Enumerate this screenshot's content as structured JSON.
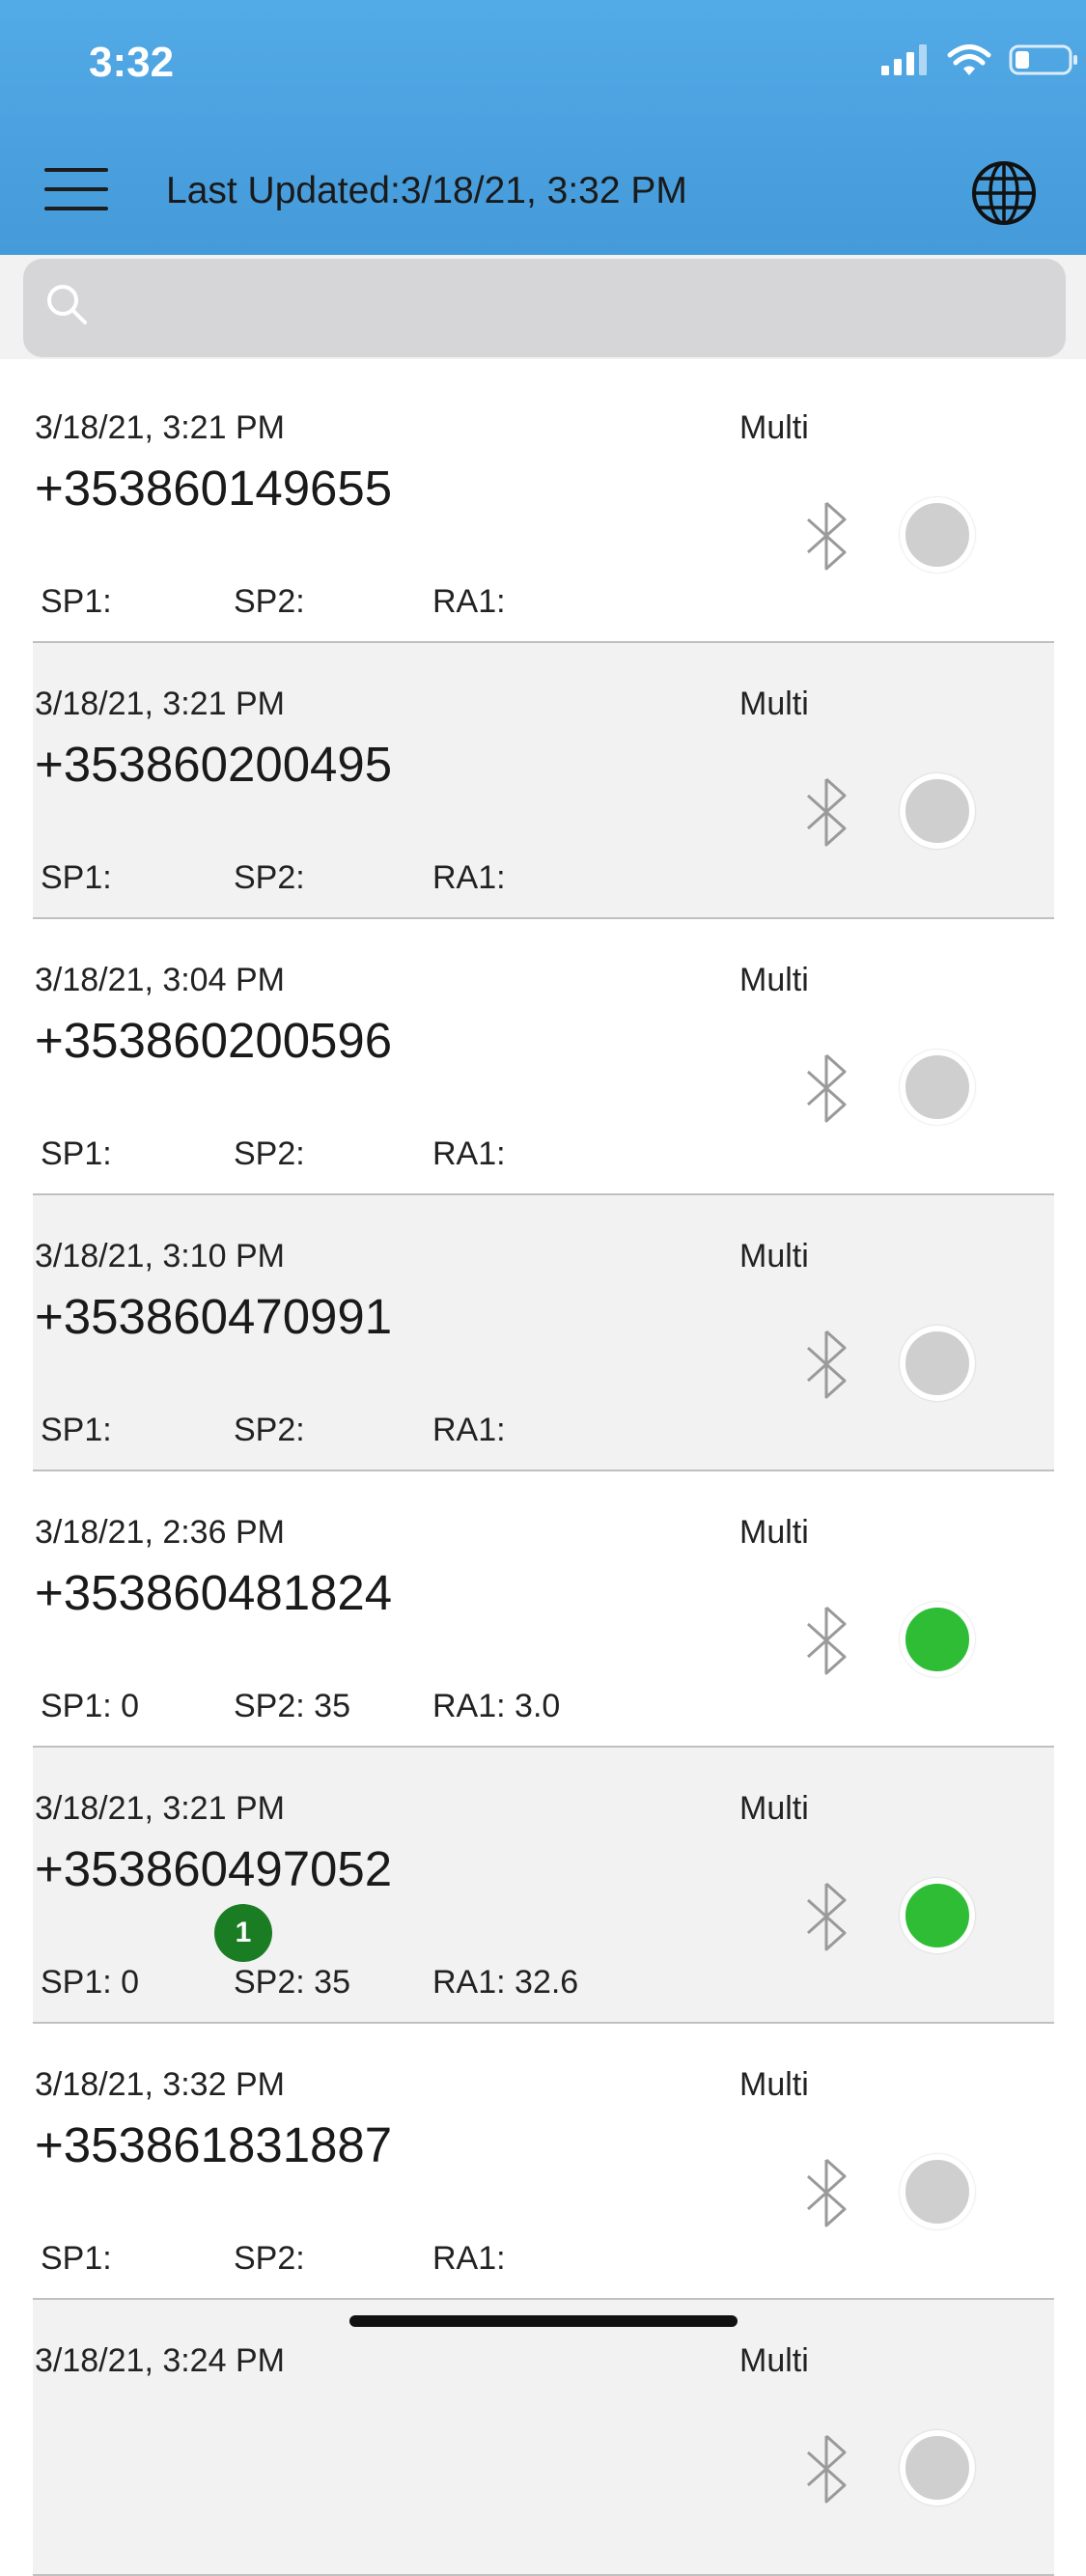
{
  "status_bar": {
    "time": "3:32"
  },
  "header": {
    "last_updated": "Last Updated:3/18/21, 3:32 PM"
  },
  "search": {
    "placeholder": ""
  },
  "devices": [
    {
      "timestamp": "3/18/21, 3:21 PM",
      "phone": "+353860149655",
      "mode": "Multi",
      "sp1": "SP1:",
      "sp2": "SP2:",
      "ra1": "RA1:",
      "online": false,
      "badge": ""
    },
    {
      "timestamp": "3/18/21, 3:21 PM",
      "phone": "+353860200495",
      "mode": "Multi",
      "sp1": "SP1:",
      "sp2": "SP2:",
      "ra1": "RA1:",
      "online": false,
      "badge": ""
    },
    {
      "timestamp": "3/18/21, 3:04 PM",
      "phone": "+353860200596",
      "mode": "Multi",
      "sp1": "SP1:",
      "sp2": "SP2:",
      "ra1": "RA1:",
      "online": false,
      "badge": ""
    },
    {
      "timestamp": "3/18/21, 3:10 PM",
      "phone": "+353860470991",
      "mode": "Multi",
      "sp1": "SP1:",
      "sp2": "SP2:",
      "ra1": "RA1:",
      "online": false,
      "badge": ""
    },
    {
      "timestamp": "3/18/21, 2:36 PM",
      "phone": "+353860481824",
      "mode": "Multi",
      "sp1": "SP1: 0",
      "sp2": "SP2: 35",
      "ra1": "RA1: 3.0",
      "online": true,
      "badge": ""
    },
    {
      "timestamp": "3/18/21, 3:21 PM",
      "phone": "+353860497052",
      "mode": "Multi",
      "sp1": "SP1: 0",
      "sp2": "SP2: 35",
      "ra1": "RA1: 32.6",
      "online": true,
      "badge": "1"
    },
    {
      "timestamp": "3/18/21, 3:32 PM",
      "phone": "+353861831887",
      "mode": "Multi",
      "sp1": "SP1:",
      "sp2": "SP2:",
      "ra1": "RA1:",
      "online": false,
      "badge": ""
    },
    {
      "timestamp": "3/18/21, 3:24 PM",
      "phone": "",
      "mode": "Multi",
      "sp1": "",
      "sp2": "",
      "ra1": "",
      "online": false,
      "badge": ""
    }
  ],
  "colors": {
    "header": "#4aa3e0",
    "online": "#2fbd36",
    "offline": "#cfcfcf",
    "badge": "#1b7d23"
  },
  "icons": [
    "menu-icon",
    "globe-icon",
    "search-icon",
    "bluetooth-icon",
    "signal-icon",
    "wifi-icon",
    "battery-icon"
  ]
}
